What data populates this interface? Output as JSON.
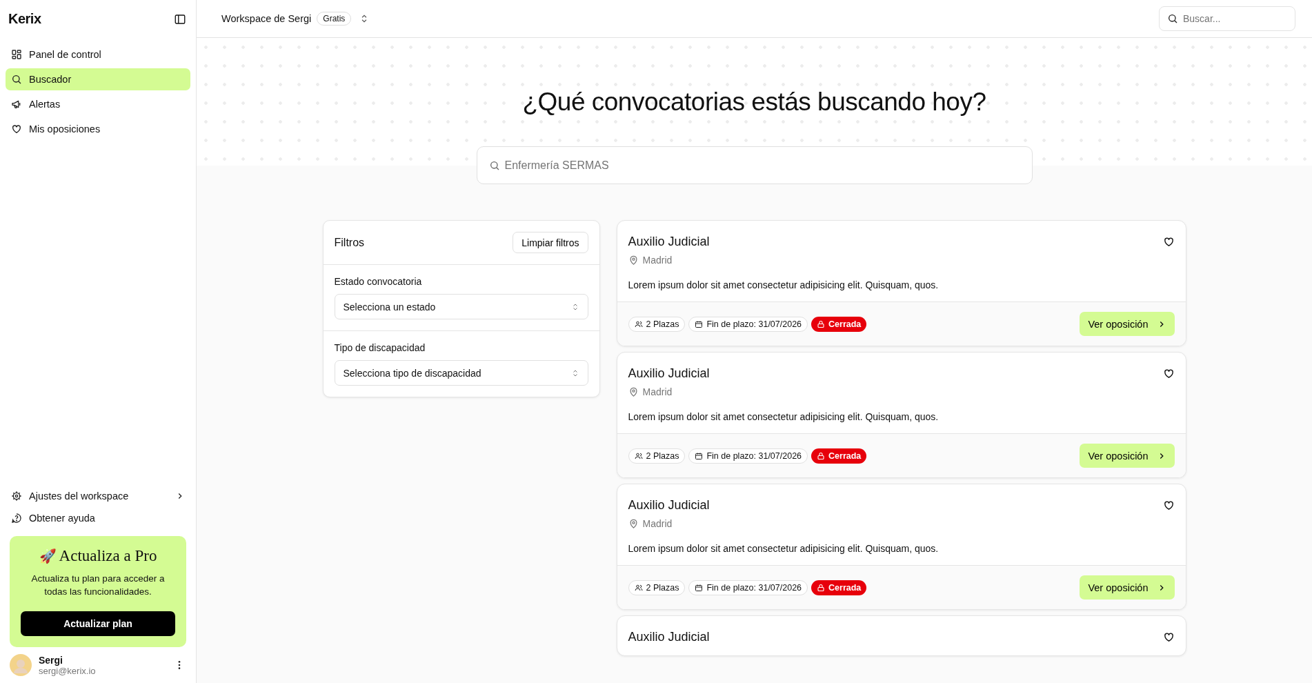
{
  "sidebar": {
    "logo": "Kerix",
    "nav": [
      {
        "label": "Panel de control",
        "selected": false
      },
      {
        "label": "Buscador",
        "selected": true
      },
      {
        "label": "Alertas",
        "selected": false
      },
      {
        "label": "Mis oposiciones",
        "selected": false
      }
    ],
    "footer_links": [
      {
        "label": "Ajustes del workspace",
        "has_arrow": true
      },
      {
        "label": "Obtener ayuda",
        "has_arrow": false
      }
    ],
    "upgrade": {
      "emoji": "🚀",
      "title": "Actualiza a Pro",
      "text": "Actualiza tu plan para acceder a todas las funcionalidades.",
      "button": "Actualizar plan"
    },
    "user": {
      "name": "Sergi",
      "email": "sergi@kerix.io"
    }
  },
  "header": {
    "workspace": "Workspace de Sergi",
    "plan": "Gratis",
    "search": {
      "placeholder": "Buscar..."
    }
  },
  "hero": {
    "title": "¿Qué convocatorias estás buscando hoy?",
    "search": {
      "placeholder": "Enfermería SERMAS"
    }
  },
  "filters": {
    "title": "Filtros",
    "clear_button": "Limpiar filtros",
    "fields": [
      {
        "label": "Estado convocatoria",
        "placeholder": "Selecciona un estado"
      },
      {
        "label": "Tipo de discapacidad",
        "placeholder": "Selecciona tipo de discapacidad"
      }
    ]
  },
  "results": [
    {
      "title": "Auxilio Judicial",
      "favorite": false,
      "location": "Madrid",
      "description": "Lorem ipsum dolor sit amet consectetur adipisicing elit. Quisquam, quos.",
      "seats": "2 Plazas",
      "deadline": "Fin de plazo: 31/07/2026",
      "status": {
        "label": "Cerrada",
        "kind": "closed"
      },
      "action": "Ver oposición"
    },
    {
      "title": "Auxilio Judicial",
      "favorite": false,
      "location": "Madrid",
      "description": "Lorem ipsum dolor sit amet consectetur adipisicing elit. Quisquam, quos.",
      "seats": "2 Plazas",
      "deadline": "Fin de plazo: 31/07/2026",
      "status": {
        "label": "Cerrada",
        "kind": "closed"
      },
      "action": "Ver oposición"
    },
    {
      "title": "Auxilio Judicial",
      "favorite": false,
      "location": "Madrid",
      "description": "Lorem ipsum dolor sit amet consectetur adipisicing elit. Quisquam, quos.",
      "seats": "2 Plazas",
      "deadline": "Fin de plazo: 31/07/2026",
      "status": {
        "label": "Cerrada",
        "kind": "closed"
      },
      "action": "Ver oposición"
    },
    {
      "title": "Auxilio Judicial",
      "favorite": false
    }
  ]
}
